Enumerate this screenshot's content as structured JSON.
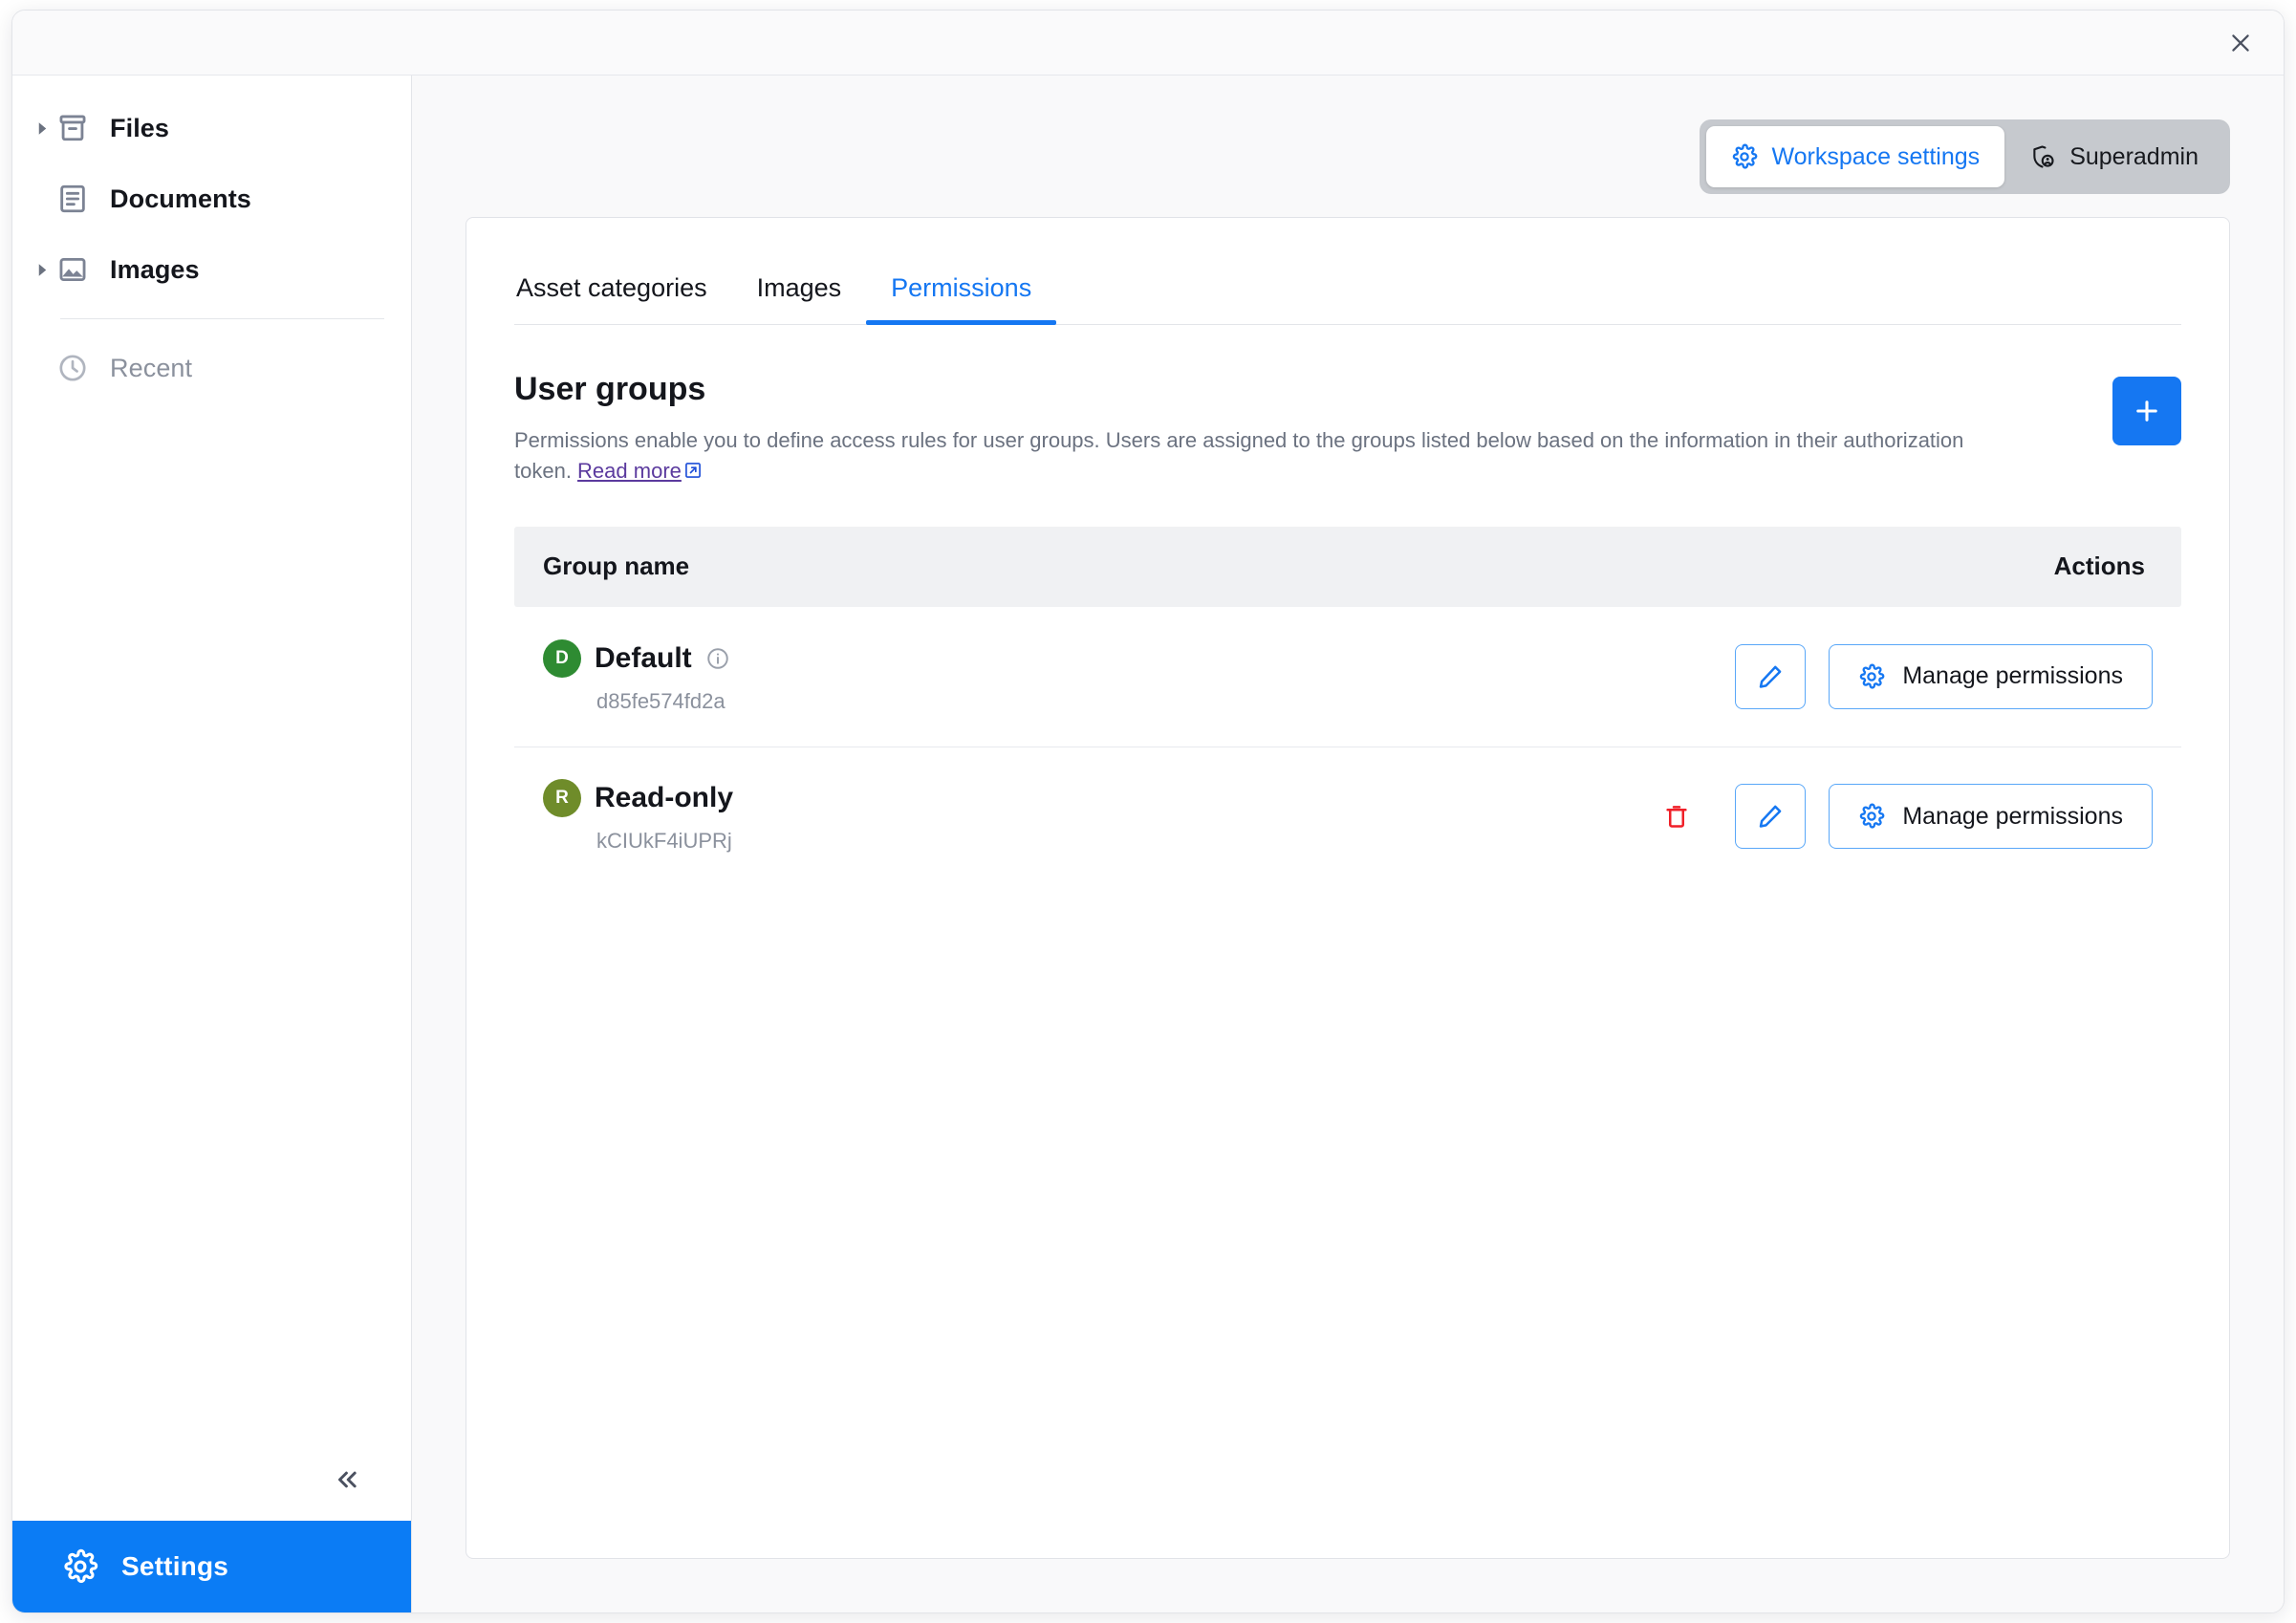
{
  "window": {
    "close_label": "Close"
  },
  "sidebar": {
    "items": [
      {
        "label": "Files",
        "icon": "archive-icon",
        "expandable": true,
        "muted": false
      },
      {
        "label": "Documents",
        "icon": "document-icon",
        "expandable": false,
        "muted": false
      },
      {
        "label": "Images",
        "icon": "image-icon",
        "expandable": true,
        "muted": false
      },
      {
        "label": "Recent",
        "icon": "clock-icon",
        "expandable": false,
        "muted": true
      }
    ],
    "collapse_icon": "chevron-double-left-icon",
    "settings_label": "Settings",
    "settings_icon": "gear-icon",
    "settings_bg": "#0b7cf5"
  },
  "mode_toggle": {
    "workspace_label": "Workspace settings",
    "workspace_icon": "gear-icon",
    "superadmin_label": "Superadmin",
    "superadmin_icon": "shield-user-icon",
    "active": "workspace",
    "active_color": "#1577f2",
    "track_color": "#c6c9ce"
  },
  "tabs": [
    {
      "label": "Asset categories",
      "active": false
    },
    {
      "label": "Images",
      "active": false
    },
    {
      "label": "Permissions",
      "active": true
    }
  ],
  "section": {
    "title": "User groups",
    "description_part1": "Permissions enable you to define access rules for user groups. Users are assigned to the groups listed below based on the information in their authorization token. ",
    "read_more_label": "Read more",
    "read_more_icon": "external-link-icon",
    "add_button_icon": "plus-icon",
    "accent": "#1577f2",
    "link_color": "#5b3a9e"
  },
  "table": {
    "headers": {
      "name": "Group name",
      "actions": "Actions"
    },
    "rows": [
      {
        "initial": "D",
        "avatar_color": "#2e8b32",
        "name": "Default",
        "id": "d85fe574fd2a",
        "has_info": true,
        "info_icon": "info-icon",
        "has_delete": false,
        "delete_icon": "trash-icon",
        "edit_icon": "pencil-icon",
        "manage_label": "Manage permissions",
        "manage_icon": "gear-icon"
      },
      {
        "initial": "R",
        "avatar_color": "#6f8c2a",
        "name": "Read-only",
        "id": "kCIUkF4iUPRj",
        "has_info": false,
        "info_icon": "info-icon",
        "has_delete": true,
        "delete_icon": "trash-icon",
        "edit_icon": "pencil-icon",
        "manage_label": "Manage permissions",
        "manage_icon": "gear-icon"
      }
    ]
  }
}
